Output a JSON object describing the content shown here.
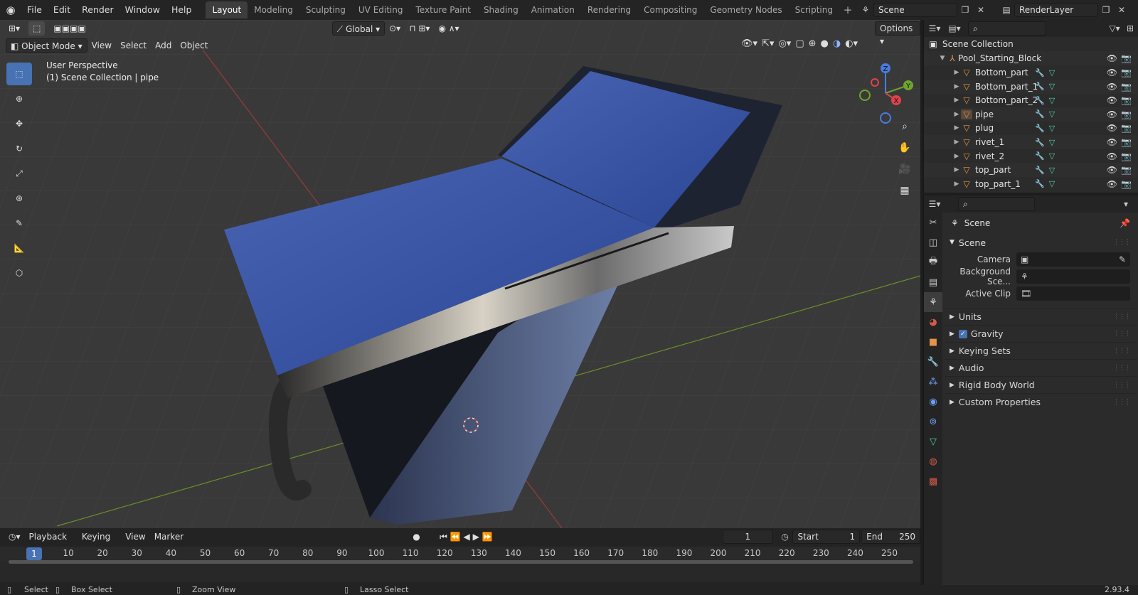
{
  "topbar": {
    "menus": [
      "File",
      "Edit",
      "Render",
      "Window",
      "Help"
    ],
    "workspaces": [
      "Layout",
      "Modeling",
      "Sculpting",
      "UV Editing",
      "Texture Paint",
      "Shading",
      "Animation",
      "Rendering",
      "Compositing",
      "Geometry Nodes",
      "Scripting"
    ],
    "active_workspace": "Layout",
    "scene_name": "Scene",
    "view_layer": "RenderLayer"
  },
  "viewport": {
    "mode": "Object Mode",
    "menus": [
      "View",
      "Select",
      "Add",
      "Object"
    ],
    "orientation": "Global",
    "options_label": "Options",
    "perspective": "User Perspective",
    "collection_info": "(1) Scene Collection | pipe",
    "gizmo_axes": {
      "x": "X",
      "y": "Y",
      "z": "Z"
    }
  },
  "timeline": {
    "menus": [
      "Playback",
      "Keying",
      "View",
      "Marker"
    ],
    "current_frame": "1",
    "start_label": "Start",
    "start": "1",
    "end_label": "End",
    "end": "250",
    "ticks": [
      "1",
      "10",
      "20",
      "30",
      "40",
      "50",
      "60",
      "70",
      "80",
      "90",
      "100",
      "110",
      "120",
      "130",
      "140",
      "150",
      "160",
      "170",
      "180",
      "190",
      "200",
      "210",
      "220",
      "230",
      "240",
      "250"
    ]
  },
  "status": {
    "select": "Select",
    "box_select": "Box Select",
    "zoom_view": "Zoom View",
    "lasso_select": "Lasso Select",
    "version": "2.93.4"
  },
  "outliner": {
    "root": "Scene Collection",
    "parent": "Pool_Starting_Block",
    "items": [
      "Bottom_part",
      "Bottom_part_1",
      "Bottom_part_2",
      "pipe",
      "plug",
      "rivet_1",
      "rivet_2",
      "top_part",
      "top_part_1"
    ]
  },
  "properties": {
    "context": "Scene",
    "panel": "Scene",
    "camera_label": "Camera",
    "bg_scene_label": "Background Sce...",
    "active_clip_label": "Active Clip",
    "subpanels": [
      "Units",
      "Gravity",
      "Keying Sets",
      "Audio",
      "Rigid Body World",
      "Custom Properties"
    ]
  },
  "colors": {
    "accent": "#4772b3",
    "object": "#e5924a",
    "mesh": "#4fd1a7",
    "modifier": "#6f9ef5"
  }
}
